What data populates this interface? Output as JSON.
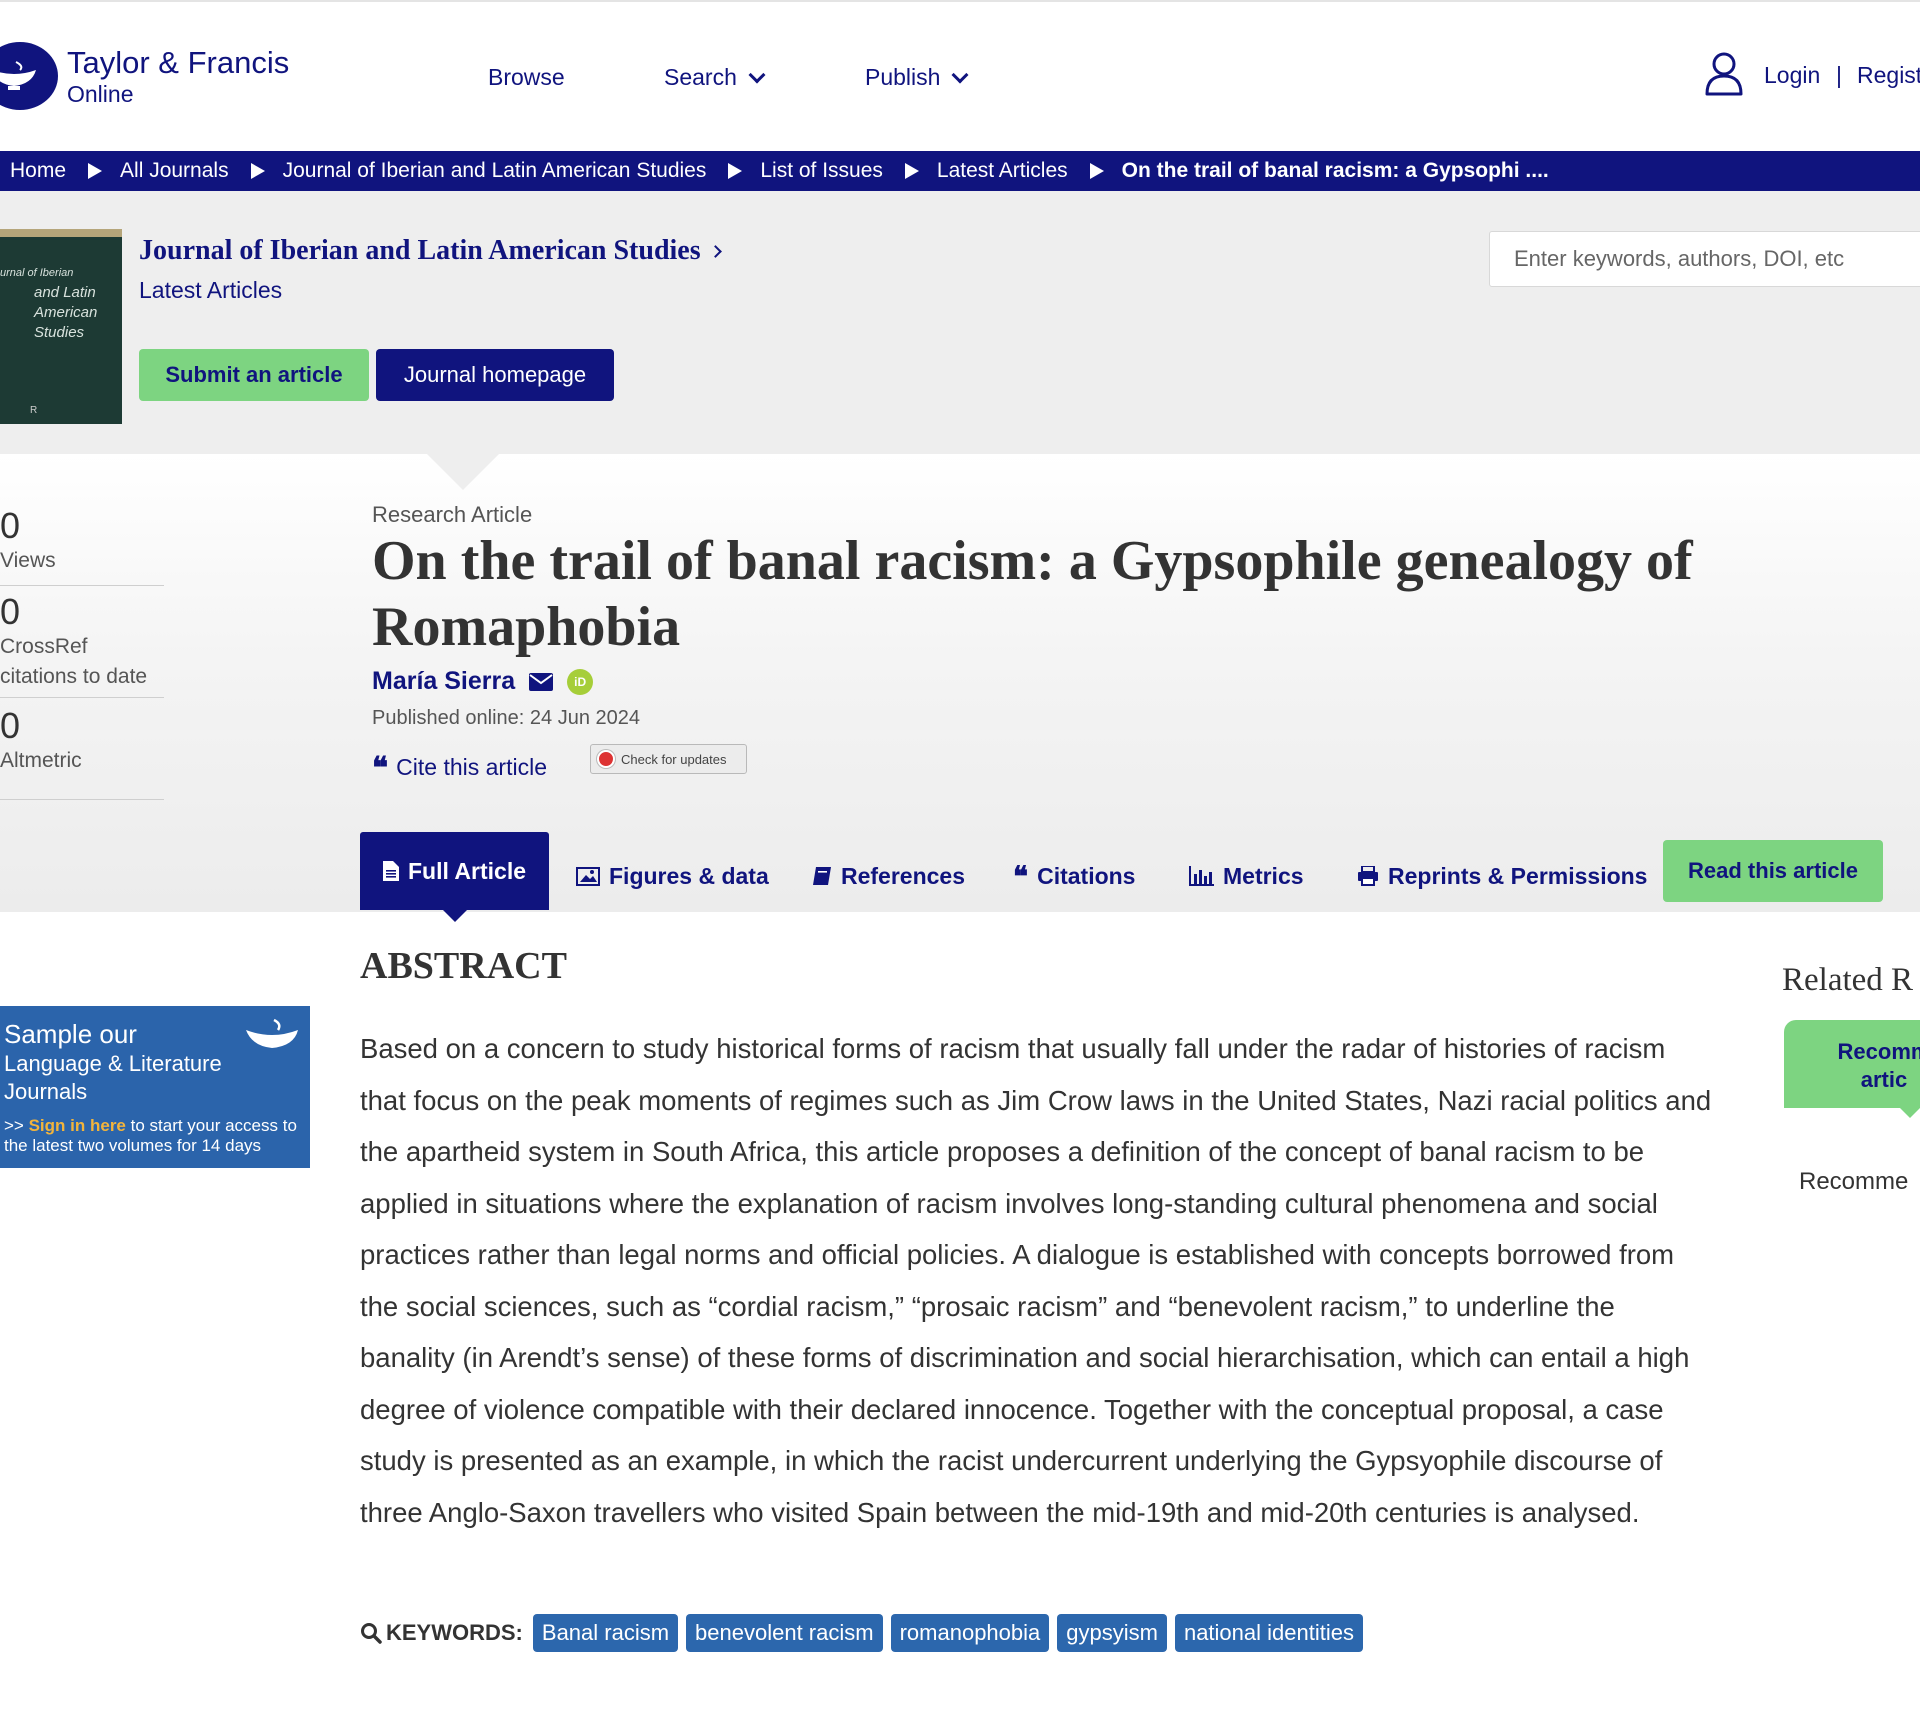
{
  "header": {
    "logo_line1": "Taylor & Francis",
    "logo_line2": "Online",
    "nav": {
      "browse": "Browse",
      "search": "Search",
      "publish": "Publish"
    },
    "login": "Login",
    "separator": "|",
    "register": "Regist"
  },
  "breadcrumb": [
    "Home",
    "All Journals",
    "Journal of Iberian and Latin American Studies",
    "List of Issues",
    "Latest Articles",
    "On the trail of banal racism: a Gypsophi ...."
  ],
  "journal": {
    "cover_text": [
      "urnal of Iberian",
      "and Latin",
      "American",
      "Studies"
    ],
    "title": "Journal of Iberian and Latin American Studies",
    "subtitle": "Latest Articles",
    "submit_label": "Submit an article",
    "homepage_label": "Journal homepage",
    "search_placeholder": "Enter keywords, authors, DOI, etc"
  },
  "metrics": {
    "views_num": "0",
    "views_label": "Views",
    "crossref_num": "0",
    "crossref_label1": "CrossRef",
    "crossref_label2": "citations to date",
    "altmetric_num": "0",
    "altmetric_label": "Altmetric"
  },
  "article": {
    "type": "Research Article",
    "title_line1": "On the trail of banal racism: a Gypsophile genealogy of",
    "title_line2": "Romaphobia",
    "author": "María Sierra",
    "published": "Published online: 24 Jun 2024",
    "cite_label": "Cite this article",
    "updates_label": "Check for updates"
  },
  "tabs": {
    "full_article": "Full Article",
    "figures": "Figures & data",
    "references": "References",
    "citations": "Citations",
    "metrics": "Metrics",
    "reprints": "Reprints & Permissions",
    "read": "Read this article"
  },
  "promo": {
    "line1": "Sample our",
    "line2": "Language & Literature Journals",
    "prefix": ">> ",
    "link": "Sign in here",
    "rest": " to start your access to the latest two volumes for 14 days"
  },
  "abstract": {
    "heading": "ABSTRACT",
    "text": "Based on a concern to study historical forms of racism that usually fall under the radar of histories of racism that focus on the peak moments of regimes such as Jim Crow laws in the United States, Nazi racial politics and the apartheid system in South Africa, this article proposes a definition of the concept of banal racism to be applied in situations where the explanation of racism involves long-standing cultural phenomena and social practices rather than legal norms and official policies. A dialogue is established with concepts borrowed from the social sciences, such as “cordial racism,” “prosaic racism” and “benevolent racism,” to underline the banality (in Arendt’s sense) of these forms of discrimination and social hierarchisation, which can entail a high degree of violence compatible with their declared innocence. Together with the conceptual proposal, a case study is presented as an example, in which the racist undercurrent underlying the Gypsyophile discourse of three Anglo-Saxon travellers who visited Spain between the mid-19th and mid-20th centuries is analysed."
  },
  "keywords": {
    "label": "KEYWORDS:",
    "items": [
      "Banal racism",
      "benevolent racism",
      "romanophobia",
      "gypsyism",
      "national identities"
    ]
  },
  "sidebar": {
    "related": "Related R",
    "rec_line1": "Recomm",
    "rec_line2": "artic",
    "rec_text": "Recomme"
  },
  "colors": {
    "brand": "#10147e",
    "accent_green": "#7dd481",
    "keyword_blue": "#2c67ad"
  }
}
